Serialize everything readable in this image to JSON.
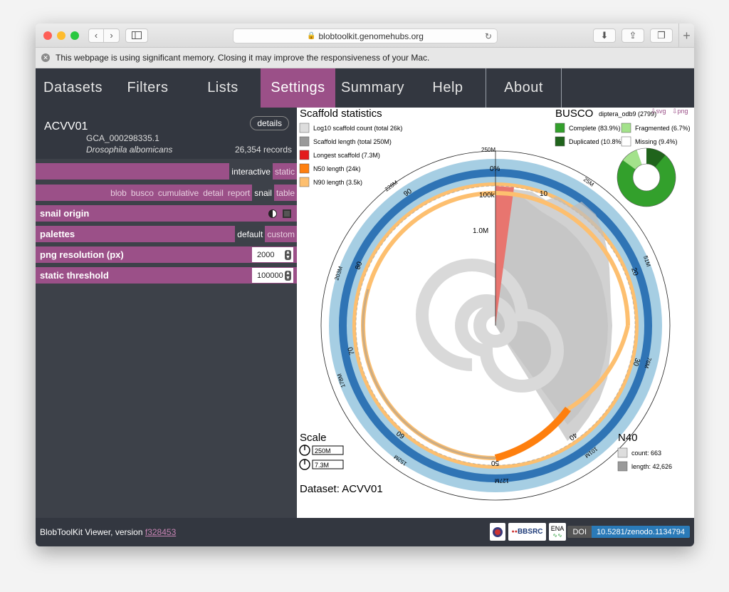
{
  "browser": {
    "url": "blobtoolkit.genomehubs.org",
    "notice": "This webpage is using significant memory. Closing it may improve the responsiveness of your Mac."
  },
  "nav": {
    "items": [
      "Datasets",
      "Filters",
      "Lists",
      "Settings",
      "Summary",
      "Help",
      "About"
    ],
    "active": "Settings"
  },
  "dataset": {
    "id": "ACVV01",
    "details_label": "details",
    "accession": "GCA_000298335.1",
    "species": "Drosophila albomicans",
    "records": "26,354 records"
  },
  "settings": {
    "mode": {
      "interactive": "interactive",
      "static": "static"
    },
    "views": [
      "blob",
      "busco",
      "cumulative",
      "detail",
      "report",
      "snail",
      "table"
    ],
    "active_view": "snail",
    "snail_origin_label": "snail origin",
    "palettes_label": "palettes",
    "palettes_default": "default",
    "palettes_custom": "custom",
    "png_resolution_label": "png resolution (px)",
    "png_resolution_value": "2000",
    "static_threshold_label": "static threshold",
    "static_threshold_value": "100000"
  },
  "snail": {
    "title": "Scaffold statistics",
    "legend": [
      {
        "label": "Log10 scaffold count (total 26k)",
        "color": "#dddddd"
      },
      {
        "label": "Scaffold length (total 250M)",
        "color": "#999999"
      },
      {
        "label": "Longest scaffold (7.3M)",
        "color": "#e31a1c"
      },
      {
        "label": "N50 length (24k)",
        "color": "#fe7f0e"
      },
      {
        "label": "N90 length (3.5k)",
        "color": "#fdbf6f"
      }
    ],
    "busco_title": "BUSCO",
    "busco_lineage": "diptera_odb9 (2799)",
    "busco_legend": [
      {
        "label": "Complete (83.9%)",
        "color": "#33a02c"
      },
      {
        "label": "Fragmented (6.7%)",
        "color": "#a3e28b"
      },
      {
        "label": "Duplicated (10.8%)",
        "color": "#20641c"
      },
      {
        "label": "Missing (9.4%)",
        "color": "#ffffff"
      }
    ],
    "download_svg": "⇩svg",
    "download_png": "⇩png",
    "outer_labels": [
      "250M",
      "25M",
      "51M",
      "76M",
      "101M",
      "127M",
      "152M",
      "178M",
      "203M",
      "228M"
    ],
    "pct_labels": [
      "0%",
      "10",
      "20",
      "30",
      "40",
      "50",
      "60",
      "70",
      "80",
      "90"
    ],
    "radial_labels": [
      "100k",
      "1.0M"
    ],
    "scale_title": "Scale",
    "scale_circum": "250M",
    "scale_radius": "7.3M",
    "n_title": "N40",
    "n_count": "count: 663",
    "n_length": "length: 42,626",
    "dataset_label": "Dataset: ACVV01"
  },
  "footer": {
    "version_prefix": "BlobToolKit Viewer, version ",
    "version": "f328453",
    "logo_bbsrc": "BBSRC",
    "logo_ena": "ENA",
    "doi_label": "DOI",
    "doi_value": "10.5281/zenodo.1134794"
  }
}
